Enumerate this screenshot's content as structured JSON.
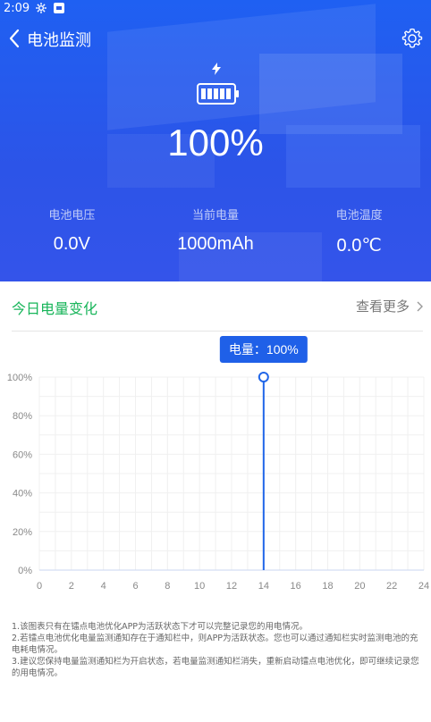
{
  "status_bar": {
    "time": "2:09"
  },
  "header": {
    "title": "电池监测"
  },
  "battery": {
    "percent": "100%"
  },
  "stats": [
    {
      "label": "电池电压",
      "value": "0.0V"
    },
    {
      "label": "当前电量",
      "value": "1000mAh"
    },
    {
      "label": "电池温度",
      "value": "0.0℃"
    }
  ],
  "section": {
    "title": "今日电量变化",
    "more_label": "查看更多"
  },
  "chart_data": {
    "type": "line",
    "x": [
      14,
      14
    ],
    "values": [
      0,
      100
    ],
    "xlim": [
      0,
      24
    ],
    "ylim": [
      0,
      100
    ],
    "x_ticks": [
      "0",
      "2",
      "4",
      "6",
      "8",
      "10",
      "12",
      "14",
      "16",
      "18",
      "20",
      "22",
      "24"
    ],
    "y_ticks": [
      "0%",
      "20%",
      "40%",
      "60%",
      "80%",
      "100%"
    ],
    "tooltip": "电量：100%",
    "grid": true,
    "line_color": "#2166e8"
  },
  "notes": [
    "1.该图表只有在镭点电池优化APP为活跃状态下才可以完整记录您的用电情况。",
    "2.若镭点电池优化电量监测通知存在于通知栏中，则APP为活跃状态。您也可以通过通知栏实时监测电池的充电耗电情况。",
    "3.建议您保持电量监测通知栏为开启状态，若电量监测通知栏消失，重新启动镭点电池优化，即可继续记录您的用电情况。"
  ],
  "colors": {
    "hero_blue": "#1f60f2",
    "accent_green": "#18b55a",
    "chart_blue": "#2166e8"
  }
}
